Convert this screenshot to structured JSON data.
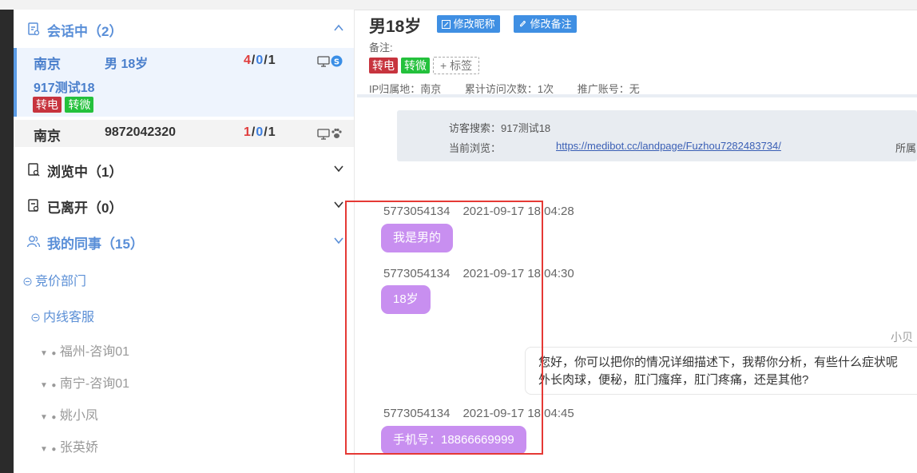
{
  "left": {
    "sections": {
      "talking": {
        "label": "会话中（2）",
        "color": "#5a8fd8"
      },
      "browsing": {
        "label": "浏览中（1）"
      },
      "left_session": {
        "label": "已离开（0）"
      },
      "colleagues": {
        "label": "我的同事（15）",
        "color": "#5a8fd8"
      }
    },
    "sessions": [
      {
        "city": "南京",
        "info": "男 18岁",
        "count_a": "4",
        "count_b": "0",
        "count_c": "1",
        "sep": "/",
        "name": "917测试18",
        "tags": [
          "转电",
          "转微"
        ],
        "icons": [
          "monitor-icon",
          "skype-icon"
        ]
      },
      {
        "city": "南京",
        "info": "9872042320",
        "count_a": "1",
        "count_b": "0",
        "count_c": "1",
        "sep": "/",
        "icons": [
          "monitor-icon",
          "paw-icon"
        ]
      }
    ],
    "tree": {
      "dept": "竞价部门",
      "group": "内线客服",
      "people": [
        "福州-咨询01",
        "南宁-咨询01",
        "姚小凤",
        "张英娇"
      ]
    }
  },
  "right": {
    "visitor_name": "男18岁",
    "btn_nick": "修改昵称",
    "btn_remark": "修改备注",
    "remark_label": "备注:",
    "tags": [
      "转电",
      "转微"
    ],
    "add_tag": "+ 标签",
    "ip_location": "IP归属地：南京",
    "visit_count": "累计访问次数：1次",
    "promo_account": "推广账号：无",
    "info_search": "访客搜索：917测试18",
    "info_browse_label": "当前浏览：",
    "info_url": "https://medibot.cc/landpage/Fuzhou7282483734/",
    "info_loc": "所属",
    "messages": [
      {
        "sender": "5773054134",
        "time": "2021-09-17 18:04:28",
        "text": "我是男的"
      },
      {
        "sender": "5773054134",
        "time": "2021-09-17 18:04:30",
        "text": "18岁"
      },
      {
        "sender": "5773054134",
        "time": "2021-09-17 18:04:45",
        "text": "手机号：18866669999"
      }
    ],
    "agent_name": "小贝",
    "agent_reply_line1": "您好，你可以把你的情况详细描述下，我帮你分析，有些什么症状呢",
    "agent_reply_line2": "外长肉球，便秘，肛门瘙痒，肛门疼痛，还是其他?"
  },
  "colors": {
    "accent": "#3f8fe3",
    "bubble": "#c88ff0",
    "tag_red": "#c7343e",
    "tag_green": "#24c13c",
    "highlight": "#e53935"
  }
}
